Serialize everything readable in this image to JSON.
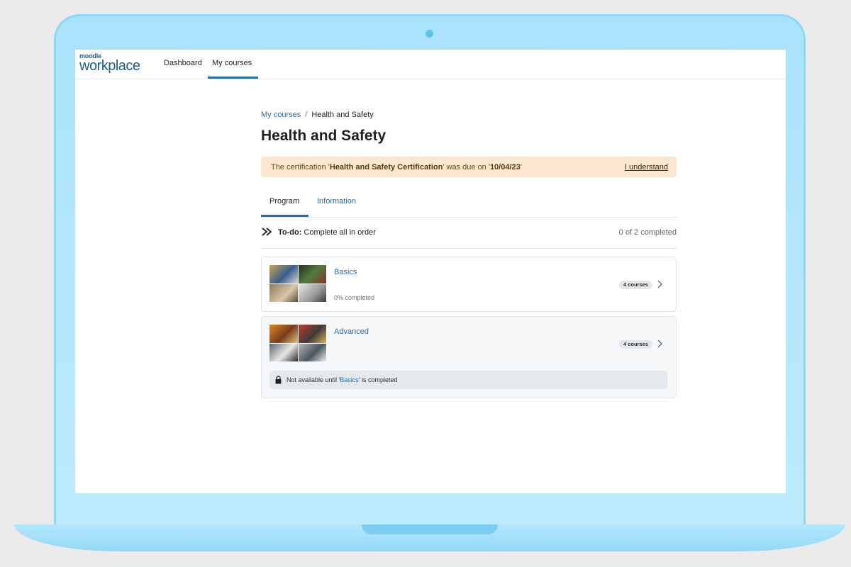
{
  "colors": {
    "accent": "#1f6fad",
    "link": "#2a6ca8",
    "alert_bg": "#fbe6cf",
    "laptop_frame": "#a9e3fb"
  },
  "logo": {
    "small": "moodle",
    "big": "workplace"
  },
  "nav": {
    "items": [
      {
        "label": "Dashboard"
      },
      {
        "label": "My courses",
        "active": true
      }
    ]
  },
  "breadcrumb": {
    "parent": "My courses",
    "separator": "/",
    "current": "Health and Safety"
  },
  "page_title": "Health and Safety",
  "alert": {
    "prefix": "The certification '",
    "cert_name": "Health and Safety Certification",
    "middle": "' was due on '",
    "due_date": "10/04/23",
    "suffix": "'",
    "action": "I understand"
  },
  "tabs": [
    {
      "label": "Program",
      "active": true
    },
    {
      "label": "Information",
      "active": false
    }
  ],
  "todo": {
    "icon": "double-chevron-right-icon",
    "label": "To-do:",
    "text": "Complete all in order",
    "progress": "0 of 2 completed"
  },
  "sets": [
    {
      "name": "Basics",
      "completion": "0% completed",
      "completion_fraction": 0,
      "badge": "4 courses",
      "locked": false
    },
    {
      "name": "Advanced",
      "badge": "4 courses",
      "locked": true,
      "lock_prefix": "Not available until '",
      "lock_link": "Basics",
      "lock_suffix": "' is completed"
    }
  ]
}
